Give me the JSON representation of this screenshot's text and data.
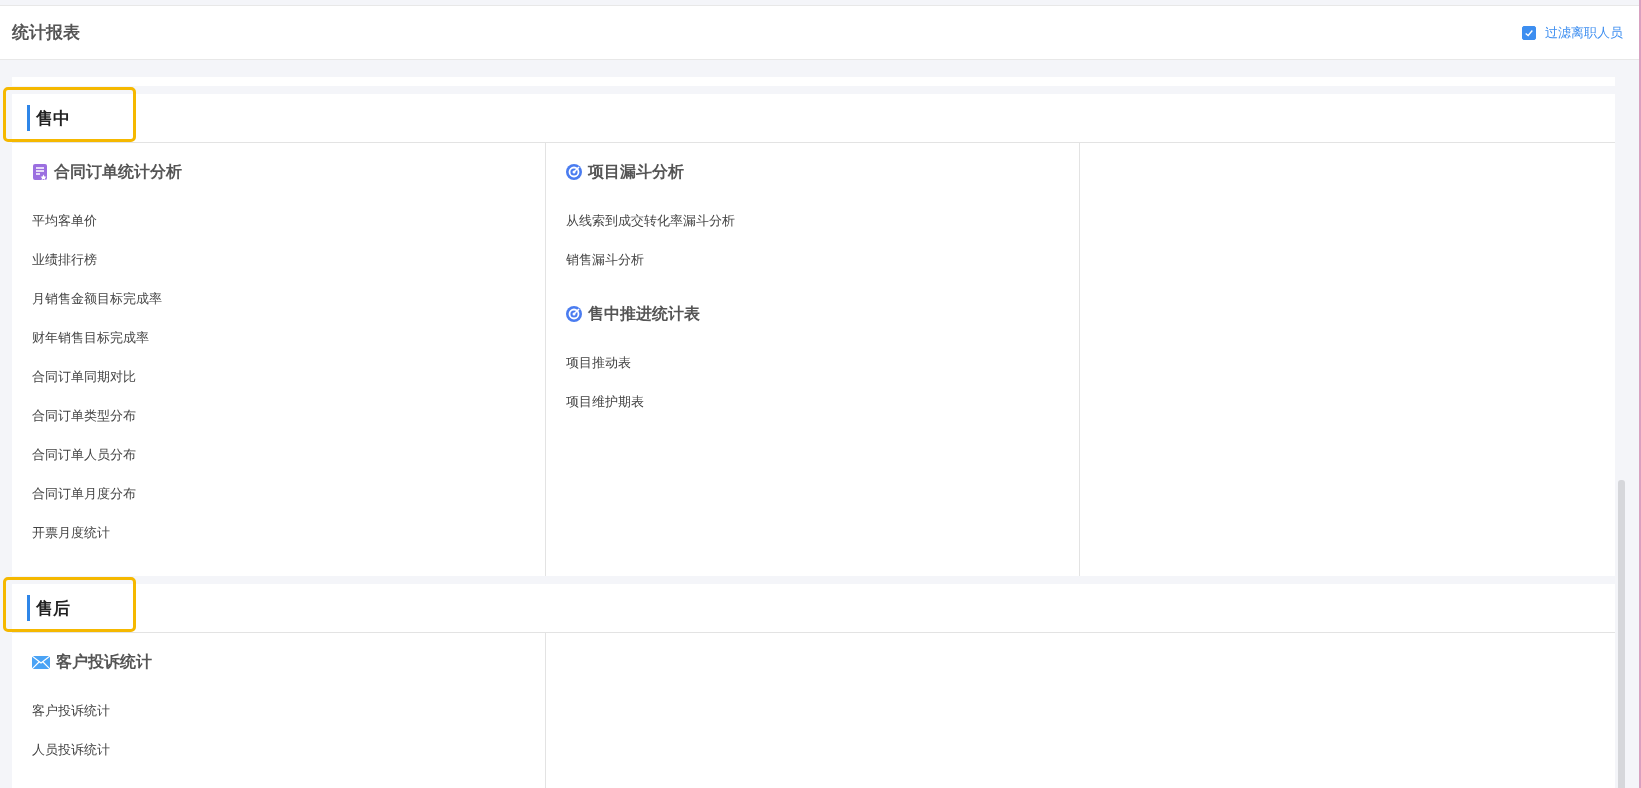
{
  "header": {
    "title": "统计报表",
    "filter": {
      "label": "过滤离职人员",
      "checked": true
    }
  },
  "sections": [
    {
      "title": "售中",
      "highlighted": true,
      "columns": [
        {
          "groups": [
            {
              "kind": "document",
              "title": "合同订单统计分析",
              "items": [
                "平均客单价",
                "业绩排行榜",
                "月销售金额目标完成率",
                "财年销售目标完成率",
                "合同订单同期对比",
                "合同订单类型分布",
                "合同订单人员分布",
                "合同订单月度分布",
                "开票月度统计"
              ]
            }
          ]
        },
        {
          "groups": [
            {
              "kind": "target",
              "title": "项目漏斗分析",
              "items": [
                "从线索到成交转化率漏斗分析",
                "销售漏斗分析"
              ]
            },
            {
              "kind": "target",
              "title": "售中推进统计表",
              "items": [
                "项目推动表",
                "项目维护期表"
              ]
            }
          ]
        },
        {}
      ]
    },
    {
      "title": "售后",
      "highlighted": true,
      "columns": [
        {
          "groups": [
            {
              "kind": "mail",
              "title": "客户投诉统计",
              "items": [
                "客户投诉统计",
                "人员投诉统计"
              ]
            }
          ]
        },
        {}
      ]
    }
  ]
}
